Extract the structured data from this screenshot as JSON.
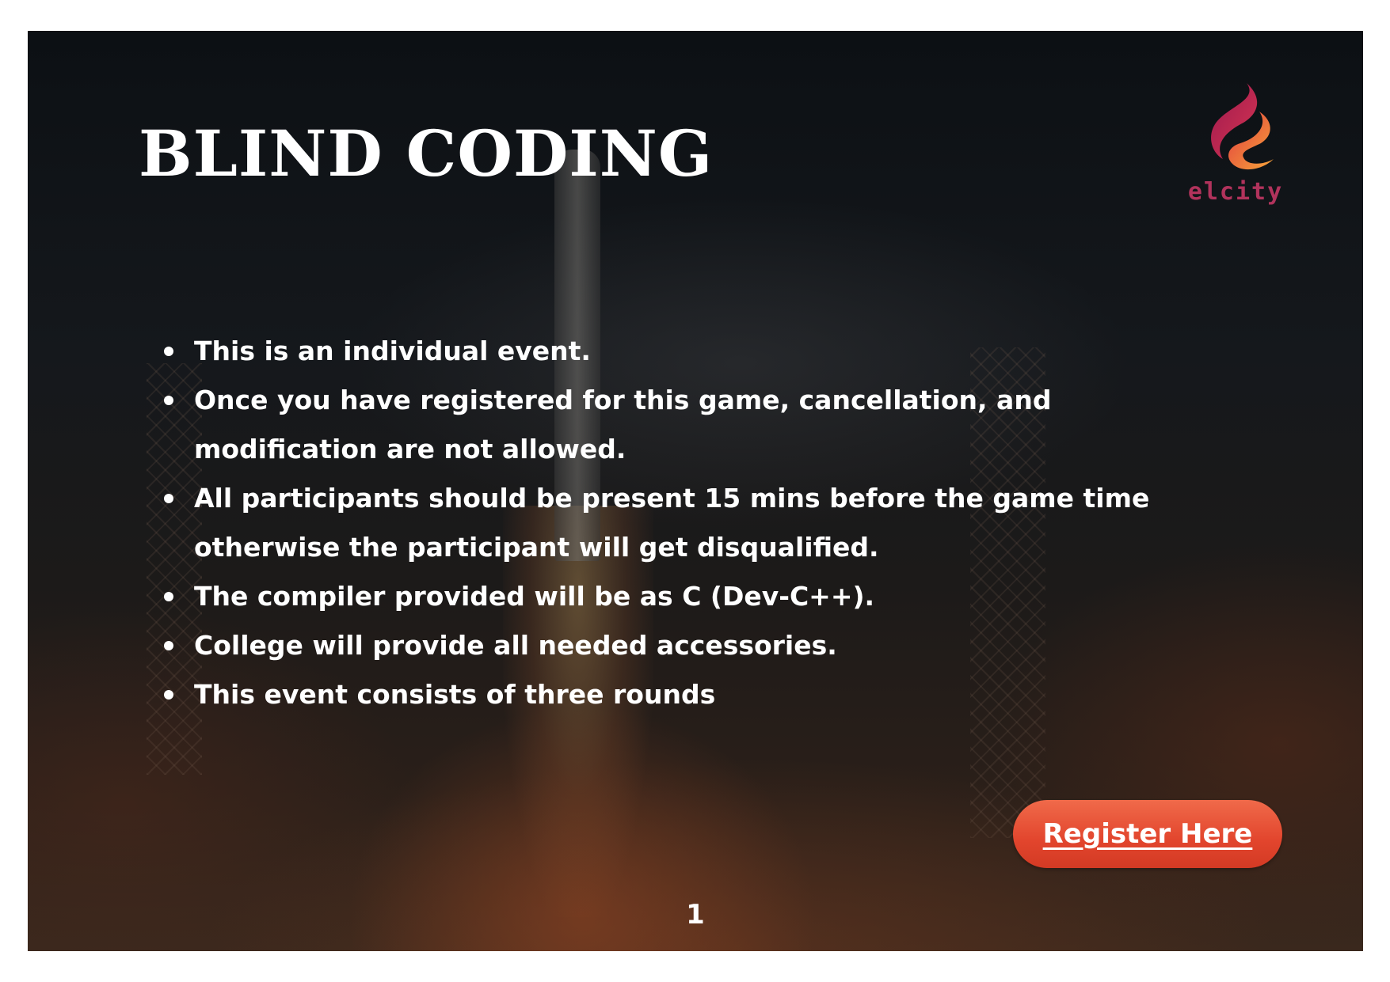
{
  "slide": {
    "title": "BLIND CODING",
    "logo": {
      "icon": "flame-icon",
      "wordmark": "elcity",
      "colors": [
        "#b31f54",
        "#e8453c",
        "#f7a23b"
      ]
    },
    "rules": [
      "This is an individual event.",
      "Once you have registered for this game, cancellation, and modification are not allowed.",
      "All participants should be present 15 mins before the game time otherwise the participant will get disqualified.",
      "The compiler provided will be as C (Dev-C++).",
      "College will provide all needed accessories.",
      "This event consists of three rounds"
    ],
    "register_button": {
      "label": "Register Here",
      "color": "#e2452d"
    },
    "page_number": "1"
  }
}
